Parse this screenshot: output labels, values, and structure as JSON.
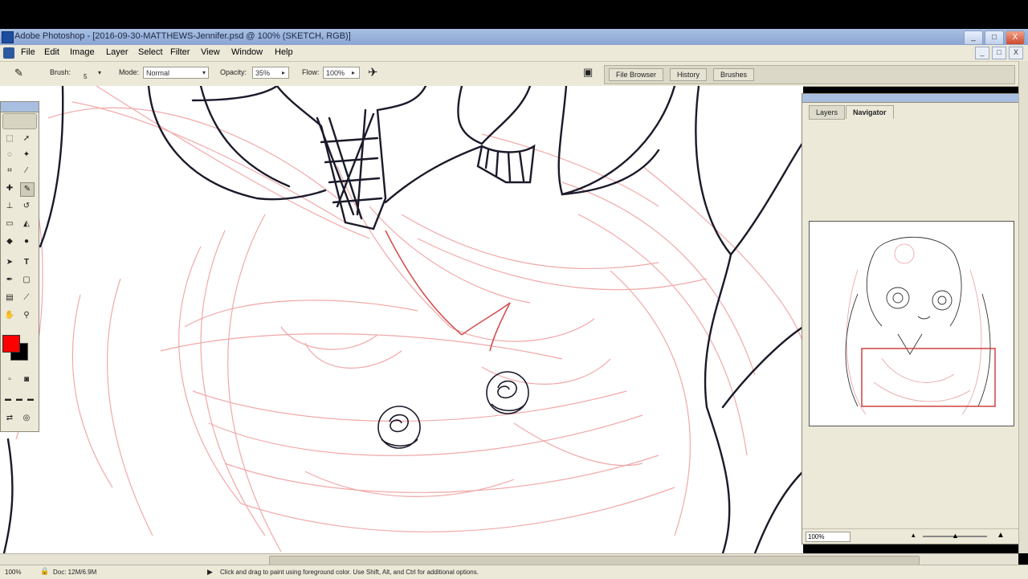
{
  "window": {
    "title": "Adobe Photoshop - [2016-09-30-MATTHEWS-Jennifer.psd @ 100% (SKETCH, RGB)]",
    "buttons": [
      "_",
      "□",
      "X"
    ]
  },
  "menubar": {
    "items": [
      "File",
      "Edit",
      "Image",
      "Layer",
      "Select",
      "Filter",
      "View",
      "Window",
      "Help"
    ],
    "doc_buttons": [
      "_",
      "□",
      "X"
    ]
  },
  "options_bar": {
    "brush_label": "Brush:",
    "brush_size": "5",
    "mode_label": "Mode:",
    "mode_value": "Normal",
    "opacity_label": "Opacity:",
    "opacity_value": "35%",
    "flow_label": "Flow:",
    "flow_value": "100%"
  },
  "palette_well": {
    "tabs": [
      "File Browser",
      "History",
      "Brushes"
    ]
  },
  "navigator_palette": {
    "tabs": [
      "Layers",
      "Navigator"
    ],
    "active_tab": "Navigator",
    "zoom_value": "100%"
  },
  "toolbox": {
    "foreground_color": "#ff0000",
    "background_color": "#000000"
  },
  "statusbar": {
    "zoom": "100%",
    "doc_info": "Doc: 12M/6.9M",
    "hint": "Click and drag to paint using foreground color. Use Shift, Alt, and Ctrl for additional options."
  },
  "colors": {
    "sketch_red": "#e88080",
    "ink_line": "#1a1a2a"
  }
}
